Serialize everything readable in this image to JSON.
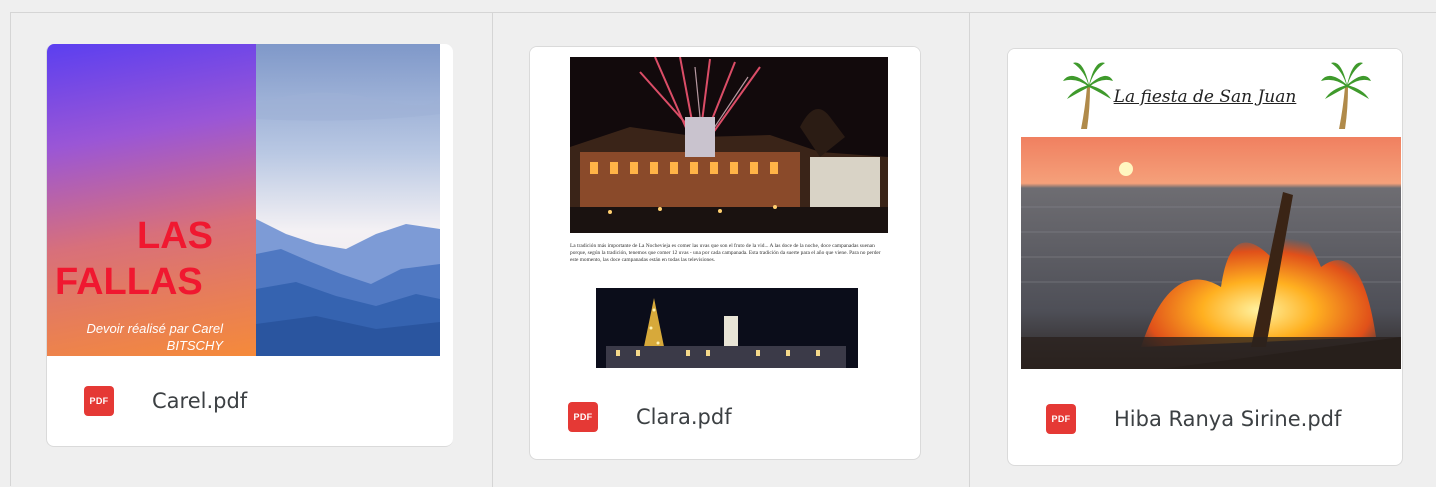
{
  "files": [
    {
      "name": "Carel.pdf",
      "icon": "pdf-icon",
      "icon_label": "PDF",
      "preview": {
        "title_line1": "LAS",
        "title_line2": "FALLAS",
        "credit_line1": "Devoir réalisé par Carel",
        "credit_line2": "BITSCHY"
      }
    },
    {
      "name": "Clara.pdf",
      "icon": "pdf-icon",
      "icon_label": "PDF",
      "preview": {
        "paragraph": "La tradición más importante de La Nochevieja es comer las uvas que son el fruto de la vid... A las doce de la noche, doce campanadas suenan porque, según la tradición, tenemos que comer 12 uvas - una por cada campanada. Esta tradición da suerte para el año que viene. Para no perder este momento, las doce campanadas están en todas las televisiones."
      }
    },
    {
      "name": "Hiba Ranya Sirine.pdf",
      "icon": "pdf-icon",
      "icon_label": "PDF",
      "preview": {
        "title": "La fiesta de San Juan"
      }
    }
  ],
  "colors": {
    "pdf_red": "#e53935",
    "background": "#efefef",
    "card_border": "#dadada"
  }
}
